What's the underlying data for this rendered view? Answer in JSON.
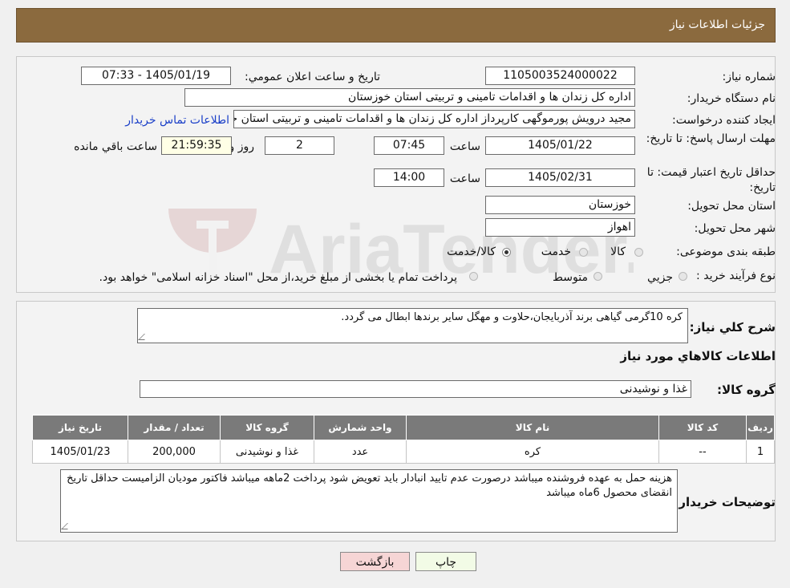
{
  "header": {
    "title": "جزئيات اطلاعات نياز"
  },
  "form": {
    "need_number_label": "شماره نياز:",
    "need_number": "1105003524000022",
    "announce_label": "تاريخ و ساعت اعلان عمومي:",
    "announce_value": "1405/01/19 - 07:33",
    "buyer_org_label": "نام دستگاه خريدار:",
    "buyer_org": "اداره کل زندان ها و اقدامات تامینی و تربیتی استان خوزستان",
    "creator_label": "ايجاد کننده درخواست:",
    "creator": "مجید درویش پورموگهی کارپرداز اداره کل زندان ها و اقدامات تامینی و تربیتی استان خوزستان",
    "contact_link": "اطلاعات تماس خريدار",
    "reply_deadline_label": "مهلت ارسال پاسخ: تا تاريخ:",
    "reply_date": "1405/01/22",
    "time_label": "ساعت",
    "reply_time": "07:45",
    "days": "2",
    "days_label": "روز و",
    "remaining": "21:59:35",
    "remaining_label": "ساعت باقي مانده",
    "price_validity_label": "حداقل تاريخ اعتبار قيمت: تا تاريخ:",
    "price_date": "1405/02/31",
    "price_time": "14:00",
    "province_label": "استان محل تحويل:",
    "province": "خوزستان",
    "city_label": "شهر محل تحويل:",
    "city": "اهواز",
    "category_label": "طبقه بندی موضوعی:",
    "category_options": [
      "کالا",
      "خدمت",
      "کالا/خدمت"
    ],
    "category_selected": "کالا/خدمت",
    "process_label": "نوع فرآيند خريد :",
    "process_options": [
      "جزيي",
      "متوسط"
    ],
    "process_note": "پرداخت تمام يا بخشی از مبلغ خريد،از محل \"اسناد خزانه اسلامی\" خواهد بود."
  },
  "details": {
    "description_label": "شرح كلي نياز:",
    "description": "کره 10گرمی گیاهی برند آذربایجان،حلاوت و مهگل سایر برندها ابطال می گردد.",
    "goods_info_title": "اطلاعات كالاهاي مورد نياز",
    "goods_group_label": "گروه كالا:",
    "goods_group": "غذا و نوشیدنی",
    "table": {
      "headers": [
        "رديف",
        "كد كالا",
        "نام كالا",
        "واحد شمارش",
        "گروه كالا",
        "تعداد / مقدار",
        "تاريخ نياز"
      ],
      "rows": [
        [
          "1",
          "--",
          "کره",
          "عدد",
          "غذا و نوشیدنی",
          "200,000",
          "1405/01/23"
        ]
      ]
    },
    "buyer_notes_label": "توضيحات خريدار:",
    "buyer_notes": "هزینه حمل به عهده فروشنده میباشد درصورت عدم تایید انبادار باید تعویض شود پرداخت 2ماهه میباشد فاکتور مودیان الزامیست حداقل تاریخ انقضای محصول 6ماه میباشد"
  },
  "buttons": {
    "print": "چاپ",
    "back": "بازگشت"
  },
  "watermark": {
    "text": "AriaTender.neT"
  },
  "colors": {
    "header": "#8b6a3e",
    "back_button": "#f6d5d5",
    "print_button": "#f2fbe6",
    "link": "#1a3fc8",
    "table_header": "#7a7a7a"
  }
}
